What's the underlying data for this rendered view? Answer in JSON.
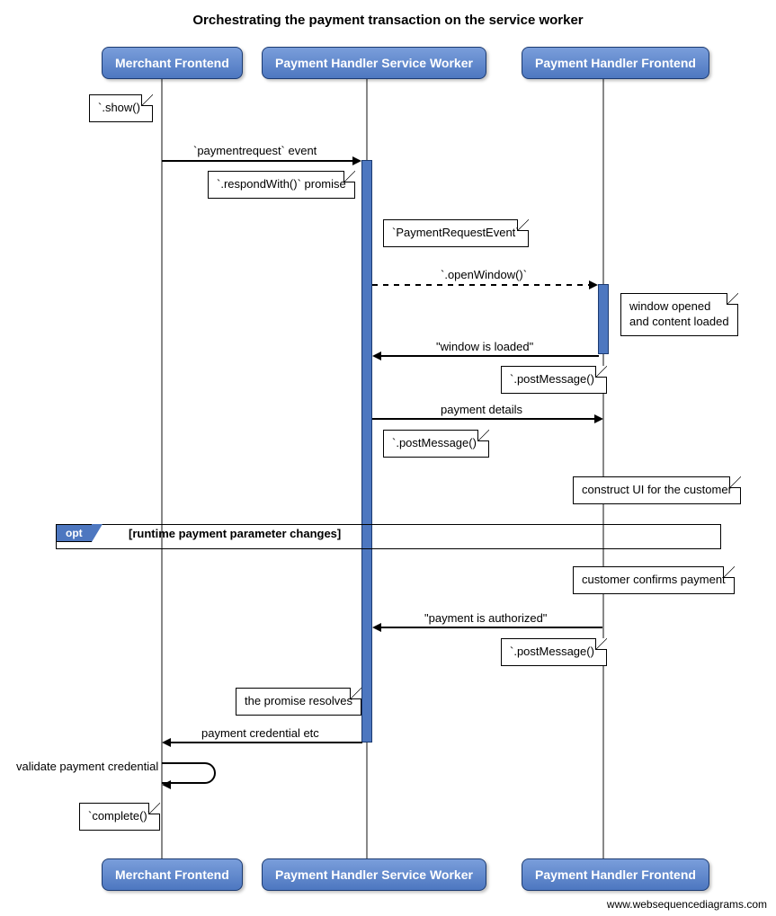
{
  "title": "Orchestrating the payment transaction on the service worker",
  "actors": {
    "merchant": "Merchant Frontend",
    "worker": "Payment Handler Service Worker",
    "frontend": "Payment Handler Frontend"
  },
  "notes": {
    "show": "`.show()`",
    "respondWith": "`.respondWith()` promise",
    "paymentRequestEvent": "`PaymentRequestEvent`",
    "windowOpened": "window opened\nand content loaded",
    "postMessage1": "`.postMessage()`",
    "postMessage2": "`.postMessage()`",
    "constructUI": "construct UI for the customer",
    "confirms": "customer confirms payment",
    "postMessage3": "`.postMessage()`",
    "promiseResolves": "the promise resolves",
    "complete": "`complete()`"
  },
  "messages": {
    "paymentrequest": "`paymentrequest` event",
    "openWindow": "`.openWindow()`",
    "windowLoaded": "\"window is loaded\"",
    "paymentDetails": "payment details",
    "paymentAuthorized": "\"payment is authorized\"",
    "paymentCredential": "payment credential etc",
    "validate": "validate payment credential"
  },
  "opt": {
    "tag": "opt",
    "condition": "[runtime payment parameter changes]"
  },
  "watermark": "www.websequencediagrams.com"
}
